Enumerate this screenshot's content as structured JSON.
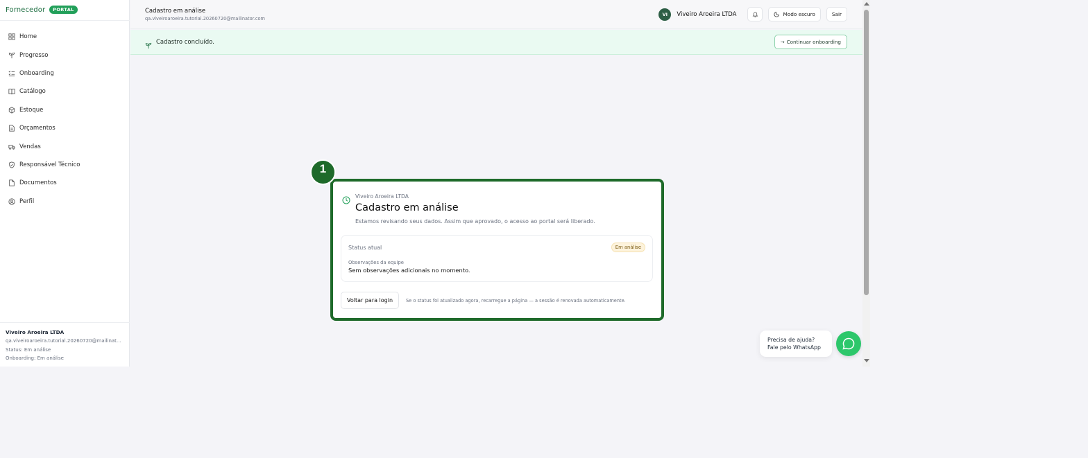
{
  "brand": {
    "name": "Fornecedor",
    "badge": "PORTAL"
  },
  "sidebar": {
    "items": [
      {
        "label": "Home",
        "icon": "grid-icon"
      },
      {
        "label": "Progresso",
        "icon": "sprout-icon"
      },
      {
        "label": "Onboarding",
        "icon": "list-checks-icon"
      },
      {
        "label": "Catálogo",
        "icon": "book-open-icon"
      },
      {
        "label": "Estoque",
        "icon": "package-icon"
      },
      {
        "label": "Orçamentos",
        "icon": "file-text-icon"
      },
      {
        "label": "Vendas",
        "icon": "truck-icon"
      },
      {
        "label": "Responsável Técnico",
        "icon": "shield-check-icon"
      },
      {
        "label": "Documentos",
        "icon": "file-icon"
      },
      {
        "label": "Perfil",
        "icon": "user-circle-icon"
      }
    ],
    "footer": {
      "name": "Viveiro Aroeira LTDA",
      "email": "qa.viveiroaroeira.tutorial.20260720@mailinator.com",
      "status": "Status: Em análise",
      "onboarding": "Onboarding: Em análise"
    }
  },
  "header": {
    "title": "Cadastro em análise",
    "subtitle": "qa.viveiroaroeira.tutorial.20260720@mailinator.com",
    "avatar_initials": "VI",
    "company": "Viveiro Aroeira LTDA",
    "dark_mode_label": "Modo escuro",
    "logout_label": "Sair"
  },
  "banner": {
    "text": "Cadastro concluído.",
    "button_label": "Continuar onboarding",
    "button_arrow": "→"
  },
  "card": {
    "step_number": "1",
    "company": "Viveiro Aroeira LTDA",
    "title": "Cadastro em análise",
    "description": "Estamos revisando seus dados. Assim que aprovado, o acesso ao portal será liberado.",
    "status_label": "Status atual",
    "status_badge": "Em análise",
    "obs_label": "Observações da equipe",
    "obs_text": "Sem observações adicionais no momento.",
    "login_button": "Voltar para login",
    "hint": "Se o status foi atualizado agora, recarregue a página — a sessão é renovada automaticamente."
  },
  "whatsapp": {
    "line1": "Precisa de ajuda?",
    "line2": "Fale pelo WhatsApp"
  },
  "colors": {
    "accent": "#22a05a",
    "highlight_border": "#1e6a2a",
    "banner_bg": "#eafaf2",
    "whatsapp": "#2dc76b"
  }
}
